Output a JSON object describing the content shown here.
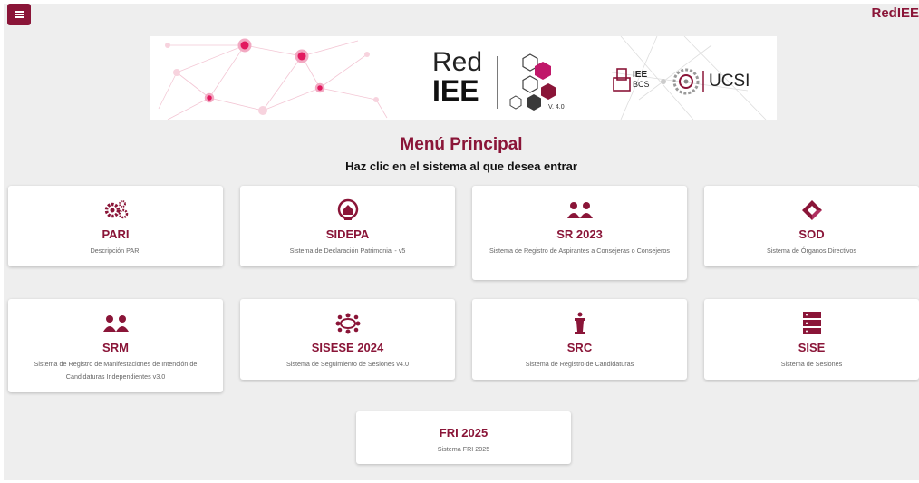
{
  "header": {
    "brand": "RedIEE",
    "menu_icon": "hamburger-menu-icon"
  },
  "banner": {
    "logo_red": "Red",
    "logo_iee": "IEE",
    "version": "V. 4.0",
    "partner_iee": "IEE",
    "partner_bcs": "BCS",
    "partner_ucsi": "UCSI"
  },
  "page": {
    "title": "Menú Principal",
    "subtitle": "Haz clic en el sistema al que desea entrar"
  },
  "colors": {
    "accent": "#8a1538",
    "background": "#eeeeee",
    "card": "#ffffff"
  },
  "systems": [
    {
      "name": "PARI",
      "description": "Descripción PARI",
      "icon": "gears-icon"
    },
    {
      "name": "SIDEPA",
      "description": "Sistema de Declaración Patrimonial - v5",
      "icon": "house-in-circle-icon"
    },
    {
      "name": "SR 2023",
      "description": "Sistema de Registro de Aspirantes a Consejeras o Consejeros",
      "icon": "people-icon"
    },
    {
      "name": "SOD",
      "description": "Sistema de Órganos Directivos",
      "icon": "diamond-chevron-icon"
    },
    {
      "name": "SRM",
      "description": "Sistema de Registro de Manifestaciones de Intención de Candidaturas Independientes v3.0",
      "icon": "users-group-icon"
    },
    {
      "name": "SISESE 2024",
      "description": "Sistema de Seguimiento de Sesiones v4.0",
      "icon": "meeting-table-icon"
    },
    {
      "name": "SRC",
      "description": "Sistema de Registro de Candidaturas",
      "icon": "podium-icon"
    },
    {
      "name": "SISE",
      "description": "Sistema de Sesiones",
      "icon": "server-icon"
    },
    {
      "name": "FRI 2025",
      "description": "Sistema FRI 2025",
      "icon": ""
    }
  ]
}
